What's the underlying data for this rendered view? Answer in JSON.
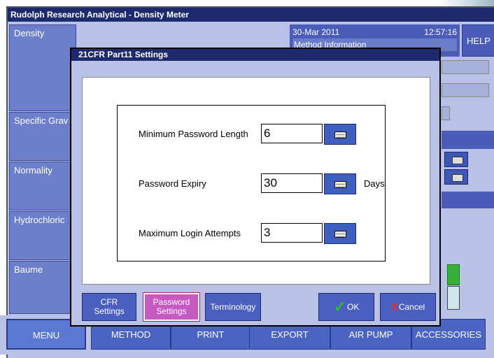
{
  "app": {
    "title": "Rudolph Research Analytical - Density Meter",
    "date": "30-Mar 2011",
    "time": "12:57:16",
    "info_label": "Method Information",
    "help_label": "HELP"
  },
  "gauges": [
    {
      "label": "Density"
    },
    {
      "label": "Specific Grav"
    },
    {
      "label": "Normality"
    },
    {
      "label": "Hydrochloric"
    },
    {
      "label": "Baume"
    }
  ],
  "nav": {
    "items": [
      {
        "label": "MENU"
      },
      {
        "label": "METHOD"
      },
      {
        "label": "PRINT"
      },
      {
        "label": "EXPORT"
      },
      {
        "label": "AIR PUMP"
      },
      {
        "label": "ACCESSORIES"
      }
    ]
  },
  "dialog": {
    "title": "21CFR Part11 Settings",
    "fields": [
      {
        "label": "Minimum Password Length",
        "value": "6"
      },
      {
        "label": "Password Expiry",
        "value": "30",
        "unit": "Days"
      },
      {
        "label": "Maximum Login Attempts",
        "value": "3"
      }
    ],
    "buttons": {
      "cfr_line1": "CFR",
      "cfr_line2": "Settings",
      "password_line1": "Password",
      "password_line2": "Settings",
      "terminology": "Terminology",
      "ok": "OK",
      "cancel": "Cancel"
    }
  },
  "colors": {
    "title_bar": "#1d2a6e",
    "panel": "#6d7fcb",
    "button": "#4a5fc0",
    "active_tab": "#c65ac2",
    "ok_check": "#2ebd2e",
    "cancel_x": "#e53030"
  }
}
